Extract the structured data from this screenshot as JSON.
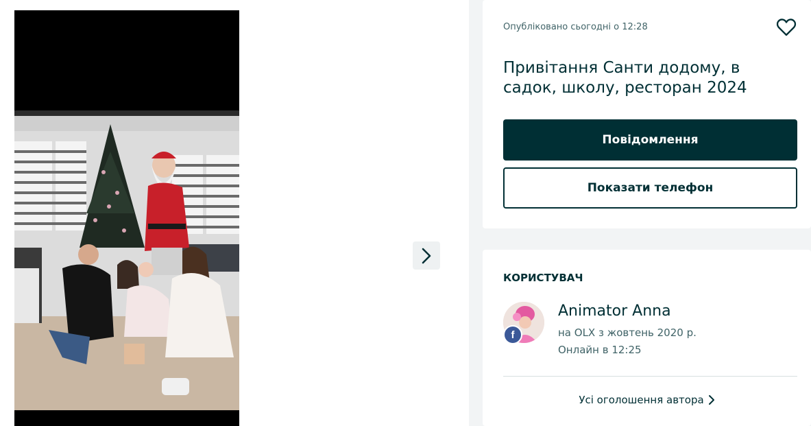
{
  "gallery": {
    "next_icon": "chevron-right-icon"
  },
  "ad": {
    "posted": "Опубліковано сьогодні о 12:28",
    "favorite_icon": "heart-icon",
    "title": "Привітання Санти додому, в садок, школу, ресторан 2024",
    "message_button": "Повідомлення",
    "phone_button": "Показати телефон"
  },
  "user": {
    "heading": "КОРИСТУВАЧ",
    "name": "Animator Anna",
    "since": "на OLX з жовтень 2020 р.",
    "online": "Онлайн в 12:25",
    "badge_icon": "facebook-icon",
    "badge_letter": "f",
    "all_ads": "Усі оголошення автора"
  },
  "colors": {
    "primary": "#002f34",
    "facebook": "#3b5998"
  }
}
